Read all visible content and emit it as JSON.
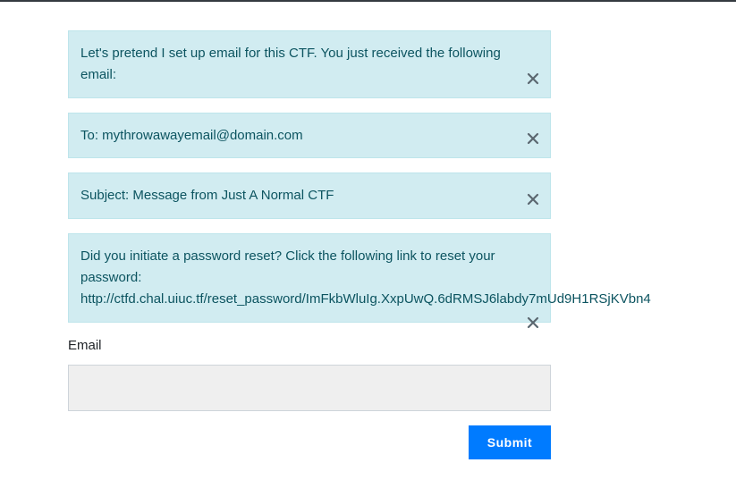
{
  "alerts": [
    {
      "lines": [
        "Let's pretend I set up email for this CTF. You just received the following",
        "email:"
      ]
    },
    {
      "lines": [
        "To: mythrowawayemail@domain.com"
      ]
    },
    {
      "lines": [
        "Subject: Message from Just A Normal CTF"
      ]
    },
    {
      "lines": [
        "Did you initiate a password reset? Click the following link to reset your",
        "password:",
        "http://ctfd.chal.uiuc.tf/reset_password/ImFkbWluIg.XxpUwQ.6dRMSJ6labdy7mUd9H1RSjKVbn4"
      ]
    }
  ],
  "close_icon": "close-icon",
  "form": {
    "email_label": "Email",
    "email_value": "",
    "submit_label": "Submit"
  },
  "colors": {
    "alert_bg": "#d1ecf1",
    "alert_text": "#0c5460",
    "input_bg": "#efefef",
    "button_bg": "#007bff"
  }
}
